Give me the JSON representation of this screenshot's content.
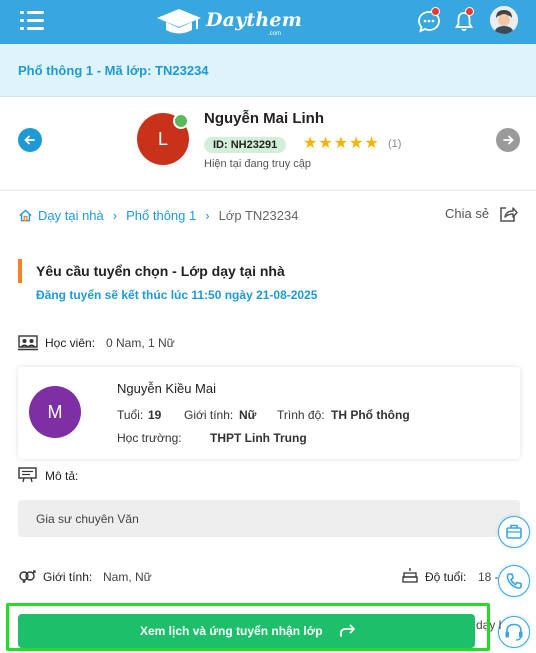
{
  "header": {
    "brand": "Daythem",
    "brand_sub": ".com",
    "icons": {
      "menu": "hamburger-menu-icon",
      "chat": "chat-icon",
      "bell": "bell-icon",
      "avatar": "user-avatar"
    },
    "colors": {
      "primary": "#38a7df",
      "badge": "#e53935"
    }
  },
  "class_bar": {
    "title": "Phổ thông 1 - Mã lớp: TN23234"
  },
  "tutor": {
    "initial": "L",
    "name": "Nguyễn Mai Linh",
    "id": "ID: NH23291",
    "rating": 5,
    "rating_count": "(1)",
    "status": "Hiện tại đang truy cập",
    "avatar_color": "#c8321a"
  },
  "breadcrumb": {
    "home": "Dạy tại nhà",
    "level": "Phổ thông 1",
    "current": "Lớp TN23234",
    "share": "Chia sẻ"
  },
  "request": {
    "title": "Yêu cầu tuyển chọn - Lớp dạy tại nhà",
    "deadline": "Đăng tuyển sẽ kết thúc lúc 11:50 ngày 21-08-2025"
  },
  "students": {
    "label": "Học viên:",
    "value": "0 Nam, 1 Nữ"
  },
  "student_card": {
    "initial": "M",
    "name": "Nguyễn Kiều Mai",
    "age_label": "Tuổi:",
    "age": "19",
    "gender_label": "Giới tính:",
    "gender": "Nữ",
    "level_label": "Trình độ:",
    "level": "TH Phổ thông",
    "school_label": "Học trường:",
    "school": "THPT Linh Trung",
    "avatar_color": "#7e2fa3"
  },
  "description": {
    "label": "Mô tả:",
    "text": "Gia sư chuyên Văn"
  },
  "requirements": {
    "gender_label": "Giới tính:",
    "gender_value": "Nam, Nữ",
    "age_label": "Độ tuổi:",
    "age_value": "18 -"
  },
  "cta": {
    "label": "Xem lịch và ứng tuyển nhận lớp",
    "partial_text": "dạy l",
    "color": "#1dbf6a",
    "highlight_color": "#22dd22"
  },
  "floating": [
    "briefcase-icon",
    "phone-icon",
    "headset-icon"
  ]
}
